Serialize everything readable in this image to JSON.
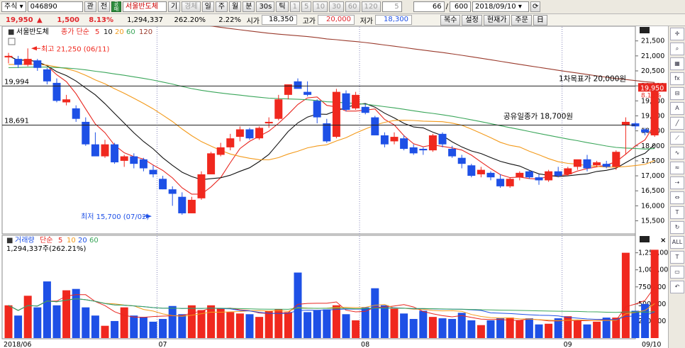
{
  "toolbar": {
    "type_label": "주식",
    "code": "046890",
    "btn_gwan": "관",
    "btn_jeon": "전",
    "green_badge": "공매",
    "stock_name": "서울반도체",
    "btn_gi": "기",
    "btn_gyeongche": "경체",
    "periods": [
      "일",
      "주",
      "월",
      "분",
      "30s",
      "틱"
    ],
    "minute_opts": [
      "1",
      "5",
      "10",
      "30",
      "60",
      "120"
    ],
    "minute_input": "5",
    "count_value": "66",
    "count_total": "600",
    "date_value": "2018/09/10"
  },
  "quote": {
    "price": "19,950",
    "arrow": "▲",
    "change": "1,500",
    "change_pct": "8.13%",
    "volume": "1,294,337",
    "volume_pct": "262.20%",
    "pct2": "2.22%",
    "open_label": "시가",
    "open_value": "18,350",
    "high_label": "고가",
    "high_value": "20,000",
    "low_label": "저가",
    "low_value": "18,300",
    "buttons": [
      "복수",
      "설정",
      "현재가",
      "주문",
      "日"
    ]
  },
  "legend": {
    "name": "서울반도체",
    "ma_label": "종가 단순",
    "ma_periods": [
      "5",
      "10",
      "20",
      "60",
      "120"
    ],
    "volume_label": "거래량",
    "volume_ma_label": "단순",
    "volume_ma_periods": [
      "5",
      "10",
      "20",
      "60"
    ],
    "volume_current": "1,294,337주(262.21%)"
  },
  "annotations": {
    "high": "최고 21,250 (06/11)",
    "low": "최저 15,700 (07/02)",
    "target": "1차목표가 20,000원",
    "close_note": "공유일종가 18,700원",
    "line1": "19,994",
    "line2": "18,691",
    "current_tag": "19,950",
    "current_pct": "8.13%"
  },
  "colors": {
    "up": "#f0281e",
    "down": "#1e50e6",
    "ma5": "#e8261f",
    "ma10": "#111111",
    "ma20": "#f39a1b",
    "ma60": "#3aa65a",
    "ma120": "#9a3a2c"
  },
  "right_tools": [
    "crosshair-icon",
    "zoom-icon",
    "palette-icon",
    "fxx-icon",
    "lock-icon",
    "text-icon",
    "line-icon",
    "trend-icon",
    "auto-icon",
    "wave-icon",
    "arrow-icon",
    "fib-icon",
    "T-icon",
    "cycle-icon",
    "all-icon",
    "T2-icon",
    "box-icon",
    "back-icon"
  ],
  "chart_data": {
    "type": "candlestick",
    "price_axis": {
      "ticks": [
        "21,500",
        "21,000",
        "20,500",
        "20,000",
        "19,500",
        "19,000",
        "18,500",
        "18,000",
        "17,500",
        "17,000",
        "16,500",
        "16,000",
        "15,500"
      ],
      "range": [
        15300,
        21800
      ]
    },
    "volume_axis": {
      "ticks": [
        "1,250,000",
        "1,000,000",
        "750,000",
        "500,000",
        "250,000"
      ],
      "range": [
        0,
        1350000
      ]
    },
    "x_labels": [
      "2018/06",
      "07",
      "08",
      "09",
      "09/10"
    ],
    "candles": [
      [
        20950,
        21100,
        20750,
        21000
      ],
      [
        20900,
        21000,
        20600,
        20700
      ],
      [
        20700,
        21250,
        20650,
        20900
      ],
      [
        20850,
        20900,
        20500,
        20600
      ],
      [
        20550,
        20600,
        20050,
        20150
      ],
      [
        20100,
        20250,
        19450,
        19500
      ],
      [
        19450,
        19700,
        19350,
        19550
      ],
      [
        19250,
        19350,
        18800,
        18900
      ],
      [
        18800,
        18950,
        18000,
        18050
      ],
      [
        18050,
        18450,
        17700,
        17650
      ],
      [
        17650,
        18200,
        17600,
        18050
      ],
      [
        18050,
        18100,
        17400,
        17450
      ],
      [
        17500,
        17700,
        17300,
        17650
      ],
      [
        17650,
        17750,
        17250,
        17400
      ],
      [
        17550,
        17600,
        17150,
        17250
      ],
      [
        17200,
        17350,
        16950,
        17050
      ],
      [
        16900,
        17000,
        16550,
        16550
      ],
      [
        16550,
        16650,
        16000,
        16400
      ],
      [
        16300,
        16450,
        15700,
        15750
      ],
      [
        15750,
        16300,
        15750,
        16200
      ],
      [
        16250,
        17150,
        16200,
        17050
      ],
      [
        17050,
        17800,
        17050,
        17750
      ],
      [
        17700,
        18100,
        17650,
        17950
      ],
      [
        17950,
        18400,
        17850,
        18250
      ],
      [
        18300,
        18650,
        18150,
        18550
      ],
      [
        18550,
        18600,
        18200,
        18250
      ],
      [
        18250,
        18650,
        18200,
        18600
      ],
      [
        18750,
        18950,
        18600,
        18800
      ],
      [
        18900,
        19700,
        18850,
        19550
      ],
      [
        19700,
        20050,
        19550,
        20050
      ],
      [
        20150,
        20250,
        19950,
        19900
      ],
      [
        19800,
        20150,
        19650,
        19700
      ],
      [
        19500,
        19550,
        18750,
        18950
      ],
      [
        18750,
        18900,
        18100,
        18150
      ],
      [
        18300,
        19900,
        18250,
        19800
      ],
      [
        19750,
        19850,
        19150,
        19200
      ],
      [
        19250,
        19800,
        19200,
        19700
      ],
      [
        19300,
        19400,
        19050,
        19100
      ],
      [
        18950,
        19000,
        18450,
        18350
      ],
      [
        18350,
        18450,
        17950,
        18050
      ],
      [
        18150,
        18450,
        18050,
        18300
      ],
      [
        18250,
        18350,
        17850,
        17900
      ],
      [
        17950,
        18050,
        17700,
        17750
      ],
      [
        17900,
        17950,
        17700,
        17850
      ],
      [
        17850,
        18400,
        17800,
        18350
      ],
      [
        18400,
        18450,
        17950,
        18050
      ],
      [
        17900,
        18000,
        17600,
        17650
      ],
      [
        17600,
        17700,
        17250,
        17400
      ],
      [
        17350,
        17400,
        16950,
        17000
      ],
      [
        17050,
        17300,
        16950,
        17200
      ],
      [
        17100,
        17150,
        16850,
        16950
      ],
      [
        16900,
        17050,
        16600,
        16650
      ],
      [
        16650,
        16950,
        16600,
        16900
      ],
      [
        16950,
        17150,
        16850,
        17100
      ],
      [
        17150,
        17200,
        16900,
        16950
      ],
      [
        16950,
        17050,
        16700,
        16850
      ],
      [
        16850,
        17200,
        16800,
        17150
      ],
      [
        17150,
        17300,
        16950,
        17000
      ],
      [
        17050,
        17300,
        17000,
        17250
      ],
      [
        17300,
        17500,
        17200,
        17550
      ],
      [
        17550,
        17700,
        17150,
        17250
      ],
      [
        17350,
        17500,
        17300,
        17450
      ],
      [
        17400,
        17500,
        17250,
        17300
      ],
      [
        17300,
        17850,
        17200,
        17800
      ],
      [
        18700,
        18950,
        17700,
        18800
      ],
      [
        18750,
        18800,
        18550,
        18650
      ],
      [
        18550,
        18600,
        18350,
        18450
      ],
      [
        18350,
        20000,
        18300,
        19950
      ]
    ],
    "volumes": [
      480,
      330,
      620,
      450,
      830,
      480,
      700,
      720,
      450,
      330,
      180,
      250,
      450,
      330,
      310,
      240,
      280,
      470,
      350,
      480,
      410,
      480,
      440,
      380,
      360,
      350,
      310,
      400,
      420,
      380,
      960,
      380,
      410,
      420,
      480,
      350,
      260,
      450,
      730,
      480,
      430,
      360,
      280,
      400,
      310,
      290,
      280,
      370,
      260,
      190,
      260,
      290,
      300,
      260,
      290,
      200,
      210,
      290,
      320,
      250,
      200,
      240,
      300,
      300,
      1250,
      400,
      500,
      1294
    ]
  }
}
